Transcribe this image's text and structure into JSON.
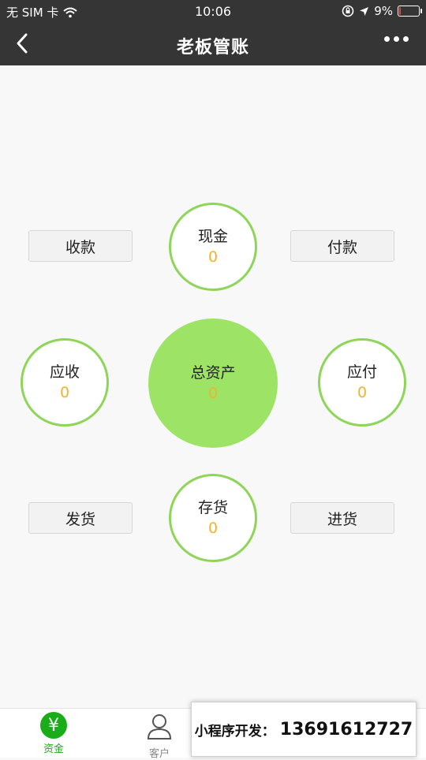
{
  "status_bar": {
    "carrier": "无 SIM 卡",
    "time": "10:06",
    "battery": "9%",
    "battery_level": 0.09
  },
  "nav": {
    "title": "老板管账",
    "back_icon": "chevron-left-icon",
    "more_icon": "more-dots-icon"
  },
  "actions": {
    "receive": "收款",
    "pay": "付款",
    "ship": "发货",
    "purchase": "进货"
  },
  "metrics": {
    "cash": {
      "label": "现金",
      "value": "0"
    },
    "receivable": {
      "label": "应收",
      "value": "0"
    },
    "total_assets": {
      "label": "总资产",
      "value": "0"
    },
    "payable": {
      "label": "应付",
      "value": "0"
    },
    "inventory": {
      "label": "存货",
      "value": "0"
    }
  },
  "tabs": {
    "funds": {
      "label": "资金",
      "icon": "yuan-icon"
    },
    "customers": {
      "label": "客户",
      "icon": "person-icon"
    }
  },
  "promo": {
    "label": "小程序开发：",
    "phone": "13691612727"
  },
  "colors": {
    "accent_green": "#1aad19",
    "circle_border": "#8ed55a",
    "center_fill": "#9de466",
    "value_yellow": "#f0b42c",
    "header_bg": "#353535"
  }
}
